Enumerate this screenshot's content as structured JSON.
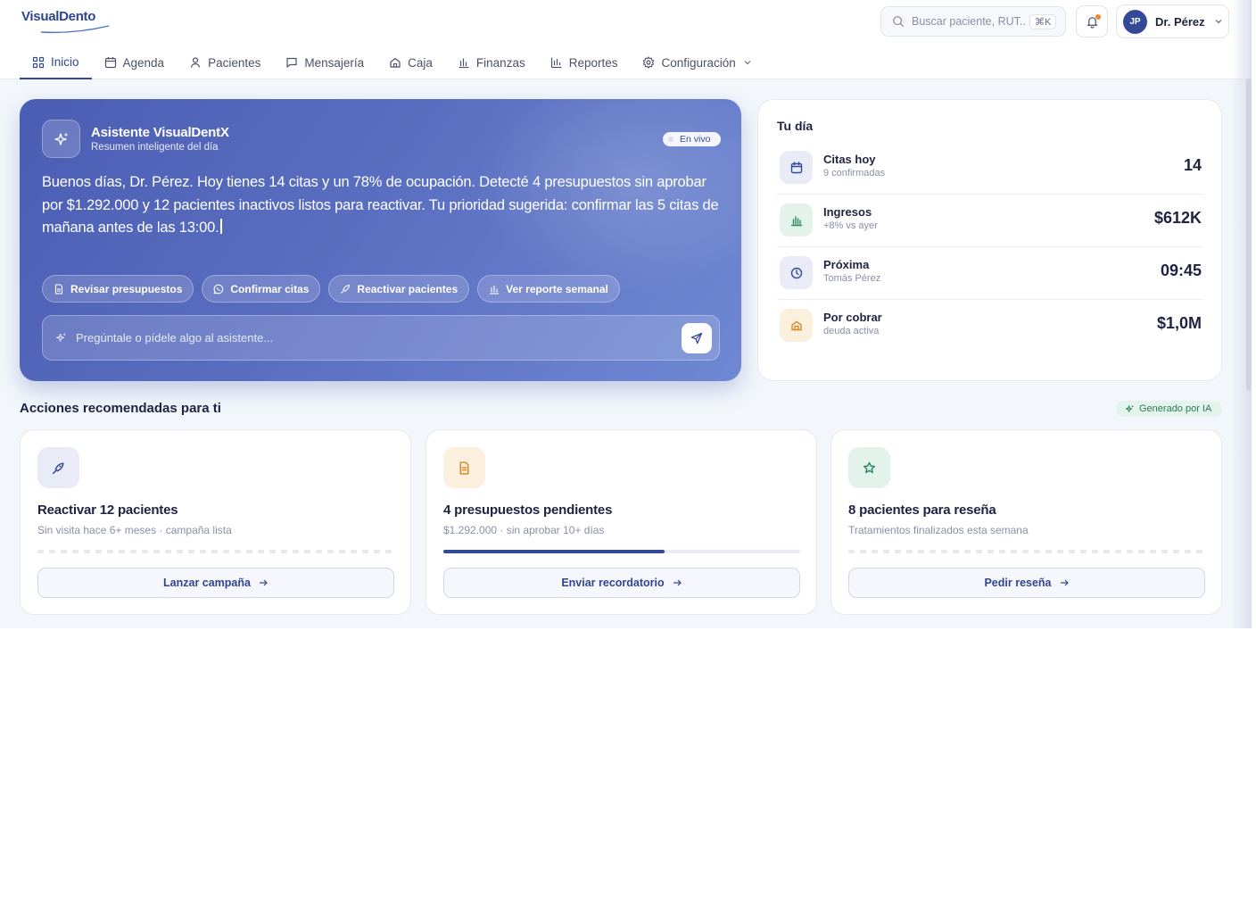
{
  "brand": {
    "logo": "VisualDento"
  },
  "search": {
    "placeholder": "Buscar paciente, RUT...",
    "shortcut": "⌘K"
  },
  "user": {
    "initials": "JP",
    "name": "Dr. Pérez"
  },
  "nav": {
    "tabs": [
      {
        "label": "Inicio",
        "icon": "grid-icon",
        "active": true
      },
      {
        "label": "Agenda",
        "icon": "calendar-icon"
      },
      {
        "label": "Pacientes",
        "icon": "user-icon"
      },
      {
        "label": "Mensajería",
        "icon": "message-icon"
      },
      {
        "label": "Caja",
        "icon": "home-icon"
      },
      {
        "label": "Finanzas",
        "icon": "bar-chart-icon"
      },
      {
        "label": "Reportes",
        "icon": "report-icon"
      },
      {
        "label": "Configuración",
        "icon": "gear-icon"
      }
    ]
  },
  "assistant": {
    "title": "Asistente VisualDentX",
    "subtitle": "Resumen inteligente del día",
    "live_label": "En vivo",
    "message": "Buenos días, Dr. Pérez. Hoy tienes 14 citas y un 78% de ocupación. Detecté 4 presupuestos sin aprobar por $1.292.000 y 12 pacientes inactivos listos para reactivar. Tu prioridad sugerida: confirmar las 5 citas de mañana antes de las 13:00.",
    "chips": [
      {
        "label": "Revisar presupuestos",
        "icon": "document-icon"
      },
      {
        "label": "Confirmar citas",
        "icon": "whatsapp-icon"
      },
      {
        "label": "Reactivar pacientes",
        "icon": "rocket-icon"
      },
      {
        "label": "Ver reporte semanal",
        "icon": "bar-chart-icon"
      }
    ],
    "ask_placeholder": "Pregúntale o pídele algo al asistente..."
  },
  "day": {
    "title": "Tu día",
    "rows": [
      {
        "label": "Citas hoy",
        "sub": "9 confirmadas",
        "value": "14",
        "icon": "calendar-icon",
        "color": "#34489a",
        "bg": "#e9ecf6"
      },
      {
        "label": "Ingresos",
        "sub": "+8% vs ayer",
        "value": "$612K",
        "icon": "bar-chart-icon",
        "color": "#2a8a62",
        "bg": "#e3f3eb"
      },
      {
        "label": "Próxima",
        "sub": "Tomás Pérez",
        "value": "09:45",
        "icon": "clock-icon",
        "color": "#34489a",
        "bg": "#e9ecf6"
      },
      {
        "label": "Por cobrar",
        "sub": "deuda activa",
        "value": "$1,0M",
        "icon": "wallet-icon",
        "color": "#d98a2b",
        "bg": "#fbefdd"
      }
    ]
  },
  "recommendations": {
    "title": "Acciones recomendadas para ti",
    "badge": "Generado por IA",
    "cards": [
      {
        "title": "Reactivar 12 pacientes",
        "sub": "Sin visita hace 6+ meses · campaña lista",
        "button": "Lanzar campaña",
        "icon": "rocket-icon",
        "color": "#34489a",
        "bg": "#e9ecf6",
        "progress": null
      },
      {
        "title": "4 presupuestos pendientes",
        "sub": "$1.292.000 · sin aprobar 10+ días",
        "button": "Enviar recordatorio",
        "icon": "document-icon",
        "color": "#d98a2b",
        "bg": "#fbefdd",
        "progress": 0.62
      },
      {
        "title": "8 pacientes para reseña",
        "sub": "Tratamientos finalizados esta semana",
        "button": "Pedir reseña",
        "icon": "star-icon",
        "color": "#2a8a62",
        "bg": "#e3f3eb",
        "progress": null
      }
    ]
  }
}
